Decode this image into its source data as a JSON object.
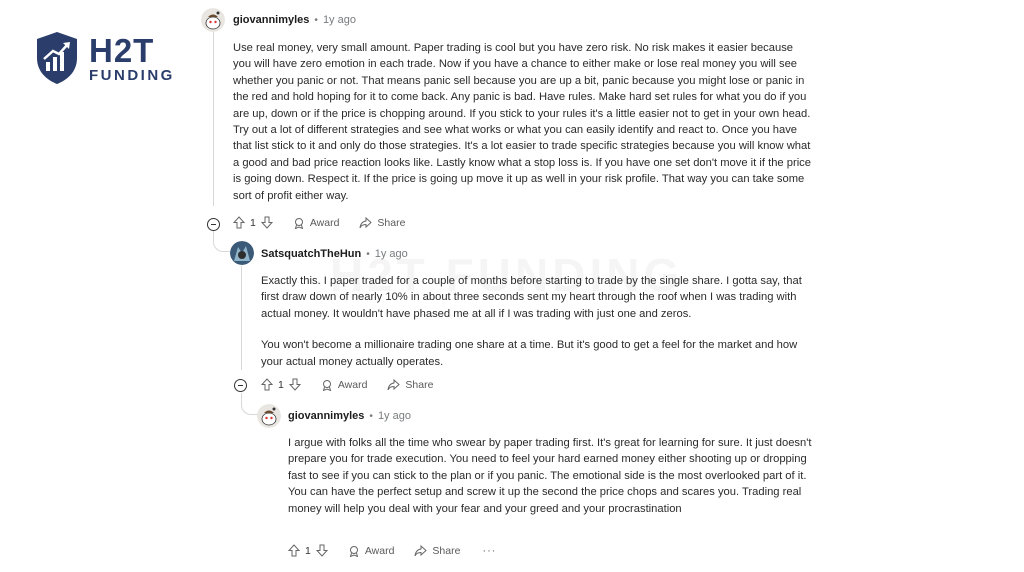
{
  "logo": {
    "brand": "H2T",
    "sub": "FUNDING"
  },
  "watermark": "H2T FUNDING",
  "comments": [
    {
      "username": "giovannimyles",
      "time": "1y ago",
      "paragraphs": [
        "Use real money, very small amount. Paper trading is cool but you have zero risk. No risk makes it easier because you will have zero emotion in each trade. Now if you have a chance to either make or lose real money you will see whether you panic or not. That means panic sell because you are up a bit, panic because you might lose or panic in the red and hold hoping for it to come back. Any panic is bad. Have rules. Make hard set rules for what you do if you are up, down or if the price is chopping around. If you stick to your rules it's a little easier not to get in your own head. Try out a lot of different strategies and see what works or what you can easily identify and react to. Once you have that list stick to it and only do those strategies. It's a lot easier to trade specific strategies because you will know what a good and bad price reaction looks like. Lastly know what a stop loss is. If you have one set don't move it if the price is going down. Respect it. If the price is going up move it up as well in your risk profile. That way you can take some sort of profit either way."
      ],
      "votes": "1",
      "award": "Award",
      "share": "Share",
      "more": "···"
    },
    {
      "username": "SatsquatchTheHun",
      "time": "1y ago",
      "paragraphs": [
        "Exactly this. I paper traded for a couple of months before starting to trade by the single share. I gotta say, that first draw down of nearly 10% in about three seconds sent my heart through the roof when I was trading with actual money. It wouldn't have phased me at all if I was trading with just one and zeros.",
        "You won't become a millionaire trading one share at a time. But it's good to get a feel for the market and how your actual money actually operates."
      ],
      "votes": "1",
      "award": "Award",
      "share": "Share",
      "more": "···"
    },
    {
      "username": "giovannimyles",
      "time": "1y ago",
      "paragraphs": [
        "I argue with folks all the time who swear by paper trading first. It's great for learning for sure. It just doesn't prepare you for trade execution. You need to feel your hard earned money either shooting up or dropping fast to see if you can stick to the plan or if you panic. The emotional side is the most overlooked part of it. You can have the perfect setup and screw it up the second the price chops and scares you. Trading real money will help you deal with your fear and your greed and your procrastination"
      ],
      "votes": "1",
      "award": "Award",
      "share": "Share",
      "more": "···"
    }
  ]
}
